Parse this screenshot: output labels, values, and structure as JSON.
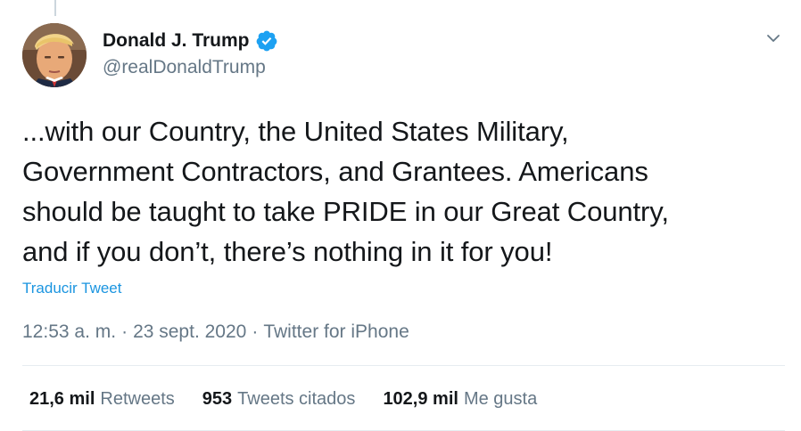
{
  "tweet": {
    "author": {
      "name": "Donald J. Trump",
      "handle": "@realDonaldTrump",
      "verified_icon": "verified-badge-icon"
    },
    "text": "...with our Country, the United States Military,\nGovernment Contractors, and Grantees. Americans\nshould be taught to take PRIDE in our Great Country,\nand if you don’t, there’s nothing in it for you!",
    "translate_label": "Traducir Tweet",
    "meta": {
      "time": "12:53 a. m.",
      "separator": "·",
      "date": "23 sept. 2020",
      "source": "Twitter for iPhone"
    },
    "stats": [
      {
        "count": "21,6 mil",
        "label": "Retweets"
      },
      {
        "count": "953",
        "label": "Tweets citados"
      },
      {
        "count": "102,9 mil",
        "label": "Me gusta"
      }
    ]
  },
  "colors": {
    "accent": "#1b95e0",
    "text": "#14171a",
    "secondary": "#657786",
    "divider": "#e6ecf0",
    "verified": "#1da1f2"
  },
  "icons": {
    "caret": "chevron-down-icon",
    "verified": "verified-badge-icon"
  }
}
